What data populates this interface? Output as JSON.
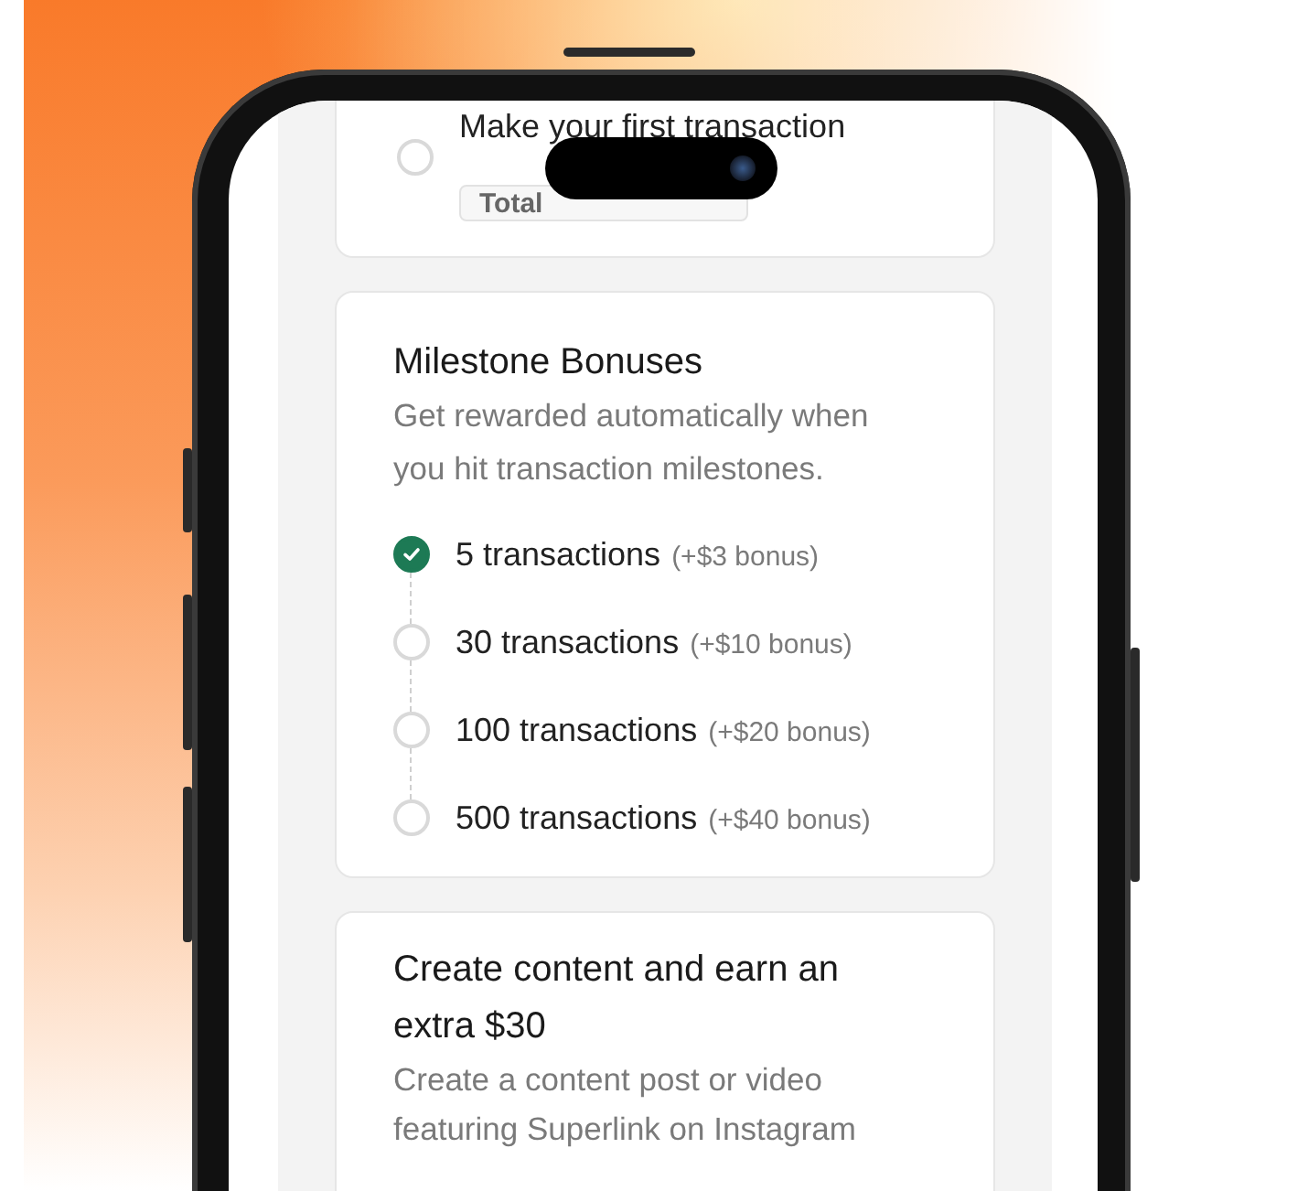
{
  "first_task": {
    "title": "Make your first transaction",
    "checked": false,
    "chip": "Total"
  },
  "milestones": {
    "title": "Milestone Bonuses",
    "description": "Get rewarded automatically when you hit transaction milestones.",
    "items": [
      {
        "label": "5 transactions",
        "bonus": "(+$3 bonus)",
        "checked": true
      },
      {
        "label": "30 transactions",
        "bonus": "(+$10 bonus)",
        "checked": false
      },
      {
        "label": "100 transactions",
        "bonus": "(+$20 bonus)",
        "checked": false
      },
      {
        "label": "500 transactions",
        "bonus": "(+$40 bonus)",
        "checked": false
      }
    ]
  },
  "content_task": {
    "title": "Create content and earn an extra $30",
    "description": "Create a content post or video featuring Superlink on Instagram"
  }
}
